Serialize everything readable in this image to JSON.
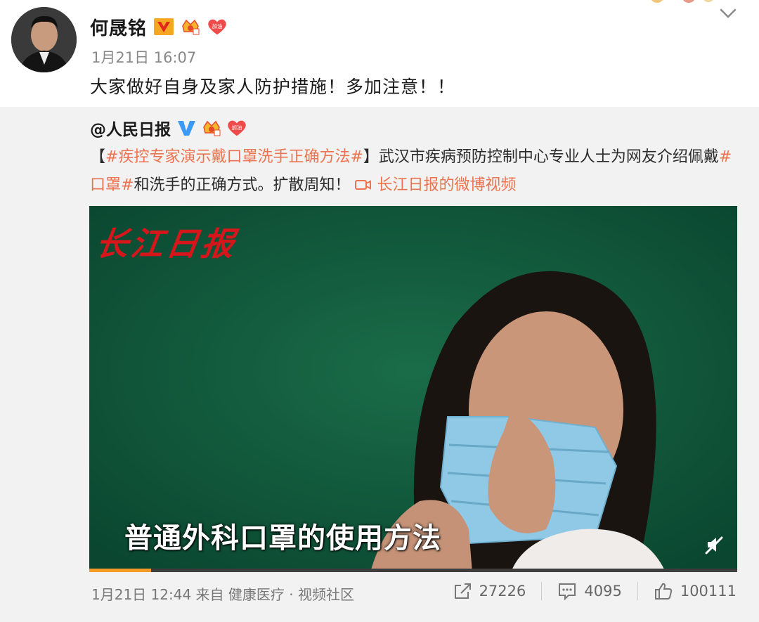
{
  "author": {
    "name": "何晟铭",
    "time": "1月21日 16:07",
    "verified_badge": "V",
    "text": "大家做好自身及家人防护措施！多加注意！！",
    "badges": [
      "crown-badge-icon",
      "jiayou-heart-badge-icon"
    ],
    "badge_text": "加油"
  },
  "repost": {
    "author_name": "@人民日报",
    "badge_text": "加油",
    "text_bracket_open": "【",
    "hashtag1": "#疾控专家演示戴口罩洗手正确方法#",
    "text_bracket_close": "】",
    "body1": "武汉市疾病预防控制中心专业人士为网友介绍佩戴",
    "hashtag2": "#口罩#",
    "body2": "和洗手的正确方式。扩散周知！ ",
    "video_link": "长江日报的微博视频",
    "video": {
      "logo": "长江日报",
      "subtitle": "普通外科口罩的使用方法",
      "progress": 0.095
    },
    "meta": "1月21日 12:44 来自 健康医疗 · 视频社区",
    "reposts": "27226",
    "comments": "4095",
    "likes": "100111"
  },
  "colors": {
    "link": "#eb7350",
    "weibo_v_blue": "#3a9af5",
    "video_bg": "#0f5a3b",
    "logo_red": "#d7161c",
    "progress": "#f59a24"
  }
}
